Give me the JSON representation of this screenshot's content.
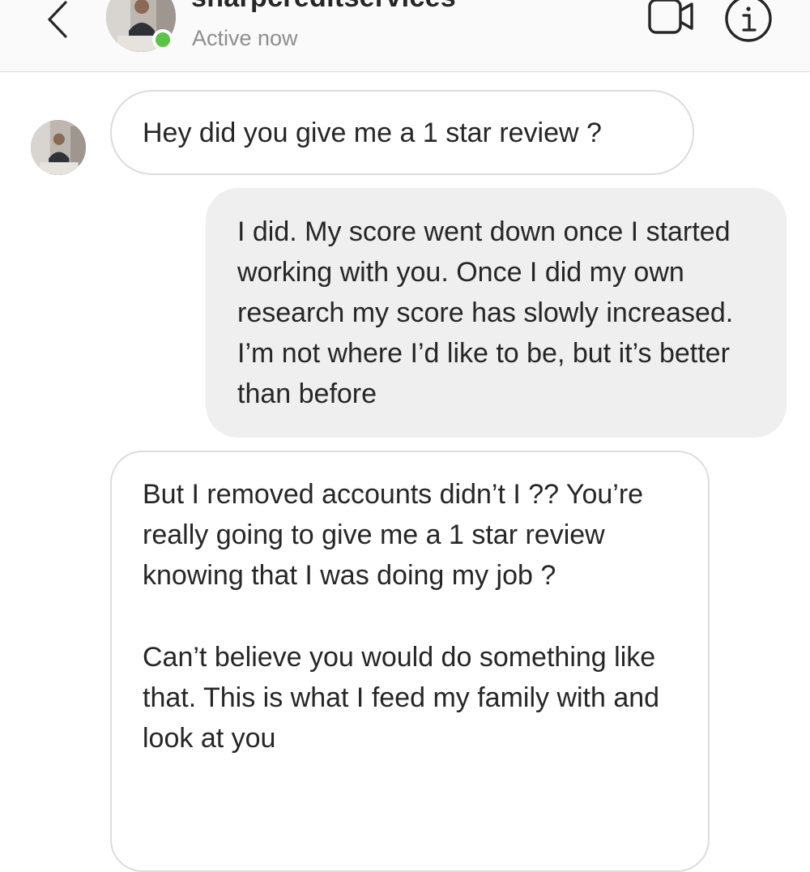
{
  "header": {
    "username": "sharpcreditservices",
    "status": "Active now",
    "back_icon": "chevron-left-icon",
    "video_icon": "video-camera-icon",
    "info_icon": "info-icon"
  },
  "colors": {
    "online": "#5ac545",
    "incoming_border": "#dcdcdc",
    "outgoing_bg": "#efefef",
    "text": "#262626",
    "muted": "#8e8e8e"
  },
  "messages": [
    {
      "direction": "incoming",
      "text": "Hey did you give me a 1 star review ?"
    },
    {
      "direction": "outgoing",
      "text": "I did. My score went down once I started working with you. Once I did my own research my score has slowly increased. I’m not where I’d like to be, but it’s better than before"
    },
    {
      "direction": "incoming",
      "paragraphs": [
        "But I removed accounts didn’t I ?? You’re really going to give me a 1 star review knowing that I was doing my job ?",
        "Can’t believe you would do something like that. This is what I feed my family with and look at you"
      ]
    }
  ]
}
